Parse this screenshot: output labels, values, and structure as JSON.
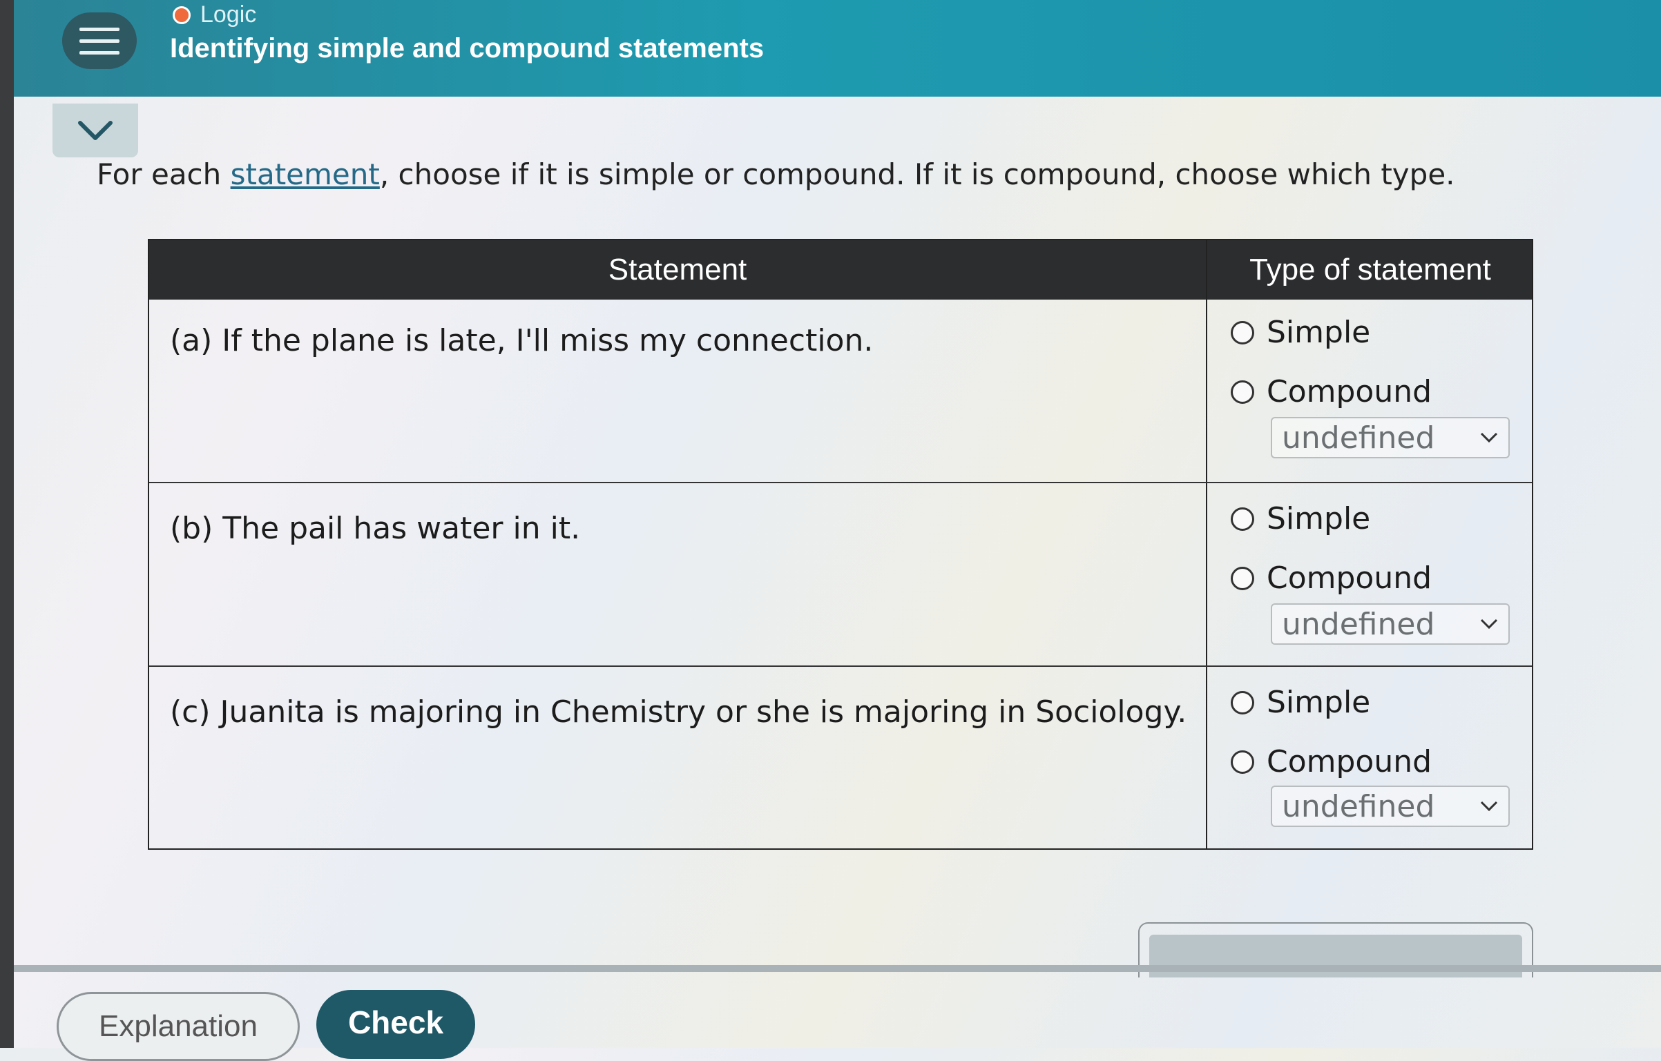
{
  "header": {
    "topic": "Logic",
    "title": "Identifying simple and compound statements"
  },
  "instruction": {
    "before": "For each ",
    "link": "statement",
    "after": ", choose if it is simple or compound. If it is compound, choose which type."
  },
  "table": {
    "headers": {
      "statement": "Statement",
      "type": "Type of statement"
    },
    "rows": [
      {
        "statement": "(a) If the plane is late, I'll miss my connection.",
        "simple_label": "Simple",
        "compound_label": "Compound",
        "select_value": "undefined"
      },
      {
        "statement": "(b) The pail has water in it.",
        "simple_label": "Simple",
        "compound_label": "Compound",
        "select_value": "undefined"
      },
      {
        "statement": "(c) Juanita is majoring in Chemistry or she is majoring in Sociology.",
        "simple_label": "Simple",
        "compound_label": "Compound",
        "select_value": "undefined"
      }
    ]
  },
  "footer": {
    "explanation_label": "Explanation",
    "check_label": "Check"
  },
  "colors": {
    "header_bg": "#1e9bb0",
    "menu_button": "#2e5862",
    "topic_dot": "#ef6a3d",
    "table_header_bg": "#2b2d2f",
    "link": "#246987",
    "check_button": "#1f5867"
  }
}
